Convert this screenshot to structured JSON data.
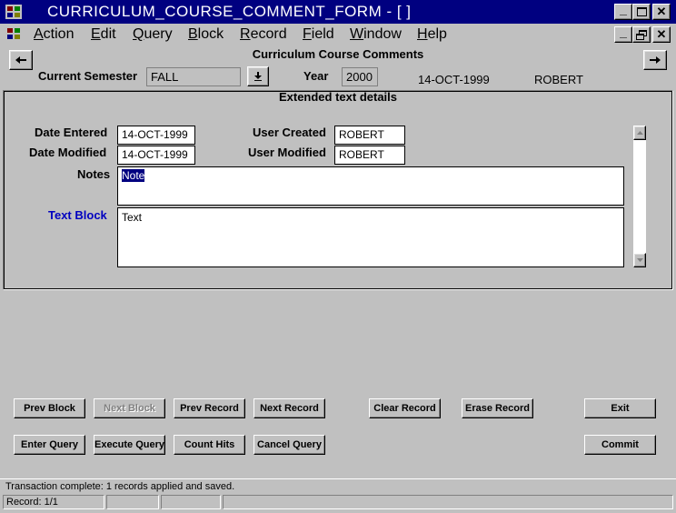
{
  "window": {
    "title": "CURRICULUM_COURSE_COMMENT_FORM - [ ]",
    "minimize_glyph": "_",
    "maximize_glyph": "□",
    "close_glyph": "✕",
    "restore_glyph": "🗗"
  },
  "menu": {
    "items": [
      {
        "first": "A",
        "rest": "ction"
      },
      {
        "first": "E",
        "rest": "dit"
      },
      {
        "first": "Q",
        "rest": "uery"
      },
      {
        "first": "B",
        "rest": "lock"
      },
      {
        "first": "R",
        "rest": "ecord"
      },
      {
        "first": "F",
        "rest": "ield"
      },
      {
        "first": "W",
        "rest": "indow"
      },
      {
        "first": "H",
        "rest": "elp"
      }
    ]
  },
  "header": {
    "form_title": "Curriculum Course Comments",
    "semester_label": "Current Semester",
    "semester_value": "FALL",
    "year_label": "Year",
    "year_value": "2000",
    "date_display": "14-OCT-1999",
    "user_display": "ROBERT"
  },
  "details": {
    "section_title": "Extended text details",
    "date_entered_label": "Date Entered",
    "date_entered_value": "14-OCT-1999",
    "date_modified_label": "Date Modified",
    "date_modified_value": "14-OCT-1999",
    "user_created_label": "User Created",
    "user_created_value": "ROBERT",
    "user_modified_label": "User Modified",
    "user_modified_value": "ROBERT",
    "notes_label": "Notes",
    "notes_value": "Note",
    "text_block_label": "Text Block",
    "text_block_value": "Text"
  },
  "buttons": {
    "prev_block": "Prev Block",
    "next_block": "Next Block",
    "prev_record": "Prev Record",
    "next_record": "Next Record",
    "clear_record": "Clear Record",
    "erase_record": "Erase Record",
    "exit": "Exit",
    "enter_query": "Enter Query",
    "execute_query": "Execute Query",
    "count_hits": "Count Hits",
    "cancel_query": "Cancel Query",
    "commit": "Commit"
  },
  "status": {
    "message": "Transaction complete: 1 records applied and saved.",
    "record": "Record: 1/1"
  },
  "colors": {
    "title_bar": "#000080",
    "text_block_label": "#0000c0",
    "selection": "#000080"
  }
}
